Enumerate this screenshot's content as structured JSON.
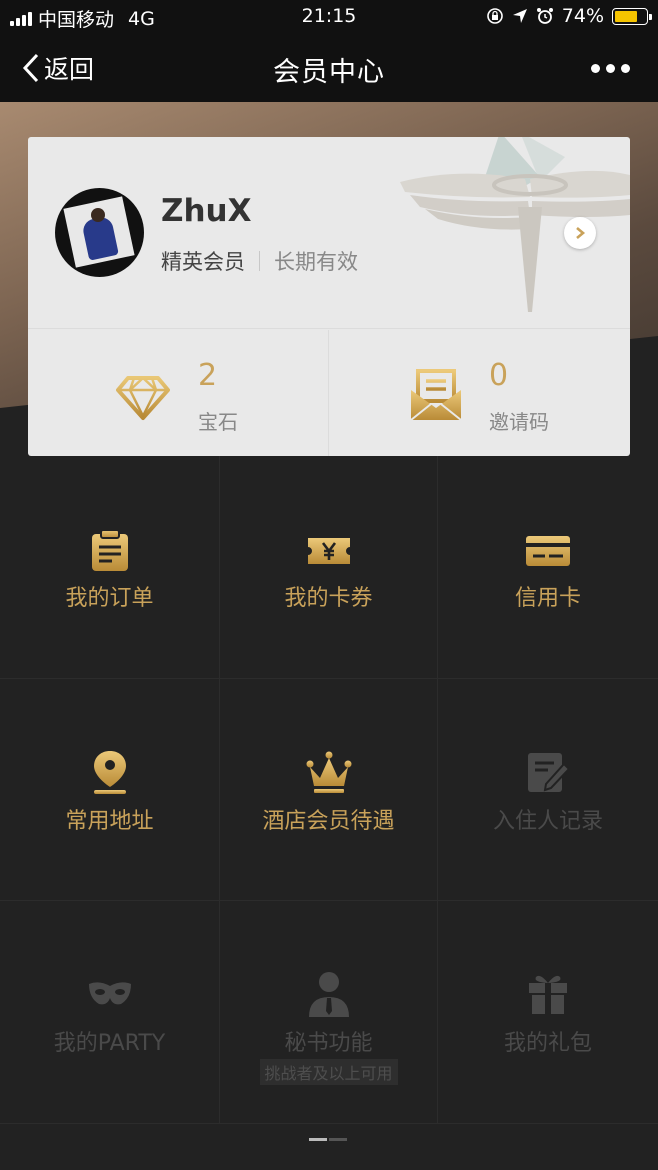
{
  "status": {
    "carrier": "中国移动",
    "network": "4G",
    "time": "21:15",
    "battery": "74%",
    "battery_level": 0.74
  },
  "nav": {
    "back_label": "返回",
    "title": "会员中心"
  },
  "card": {
    "username": "ZhuX",
    "level": "精英会员",
    "validity": "长期有效",
    "stats": [
      {
        "value": "2",
        "label": "宝石",
        "icon": "diamond-icon"
      },
      {
        "value": "0",
        "label": "邀请码",
        "icon": "envelope-icon"
      }
    ]
  },
  "grid": [
    {
      "label": "我的订单",
      "icon": "clipboard-icon",
      "enabled": true
    },
    {
      "label": "我的卡券",
      "icon": "ticket-icon",
      "enabled": true
    },
    {
      "label": "信用卡",
      "icon": "credit-card-icon",
      "enabled": true
    },
    {
      "label": "常用地址",
      "icon": "location-pin-icon",
      "enabled": true
    },
    {
      "label": "酒店会员待遇",
      "icon": "crown-icon",
      "enabled": true
    },
    {
      "label": "入住人记录",
      "icon": "edit-note-icon",
      "enabled": false
    },
    {
      "label": "我的PARTY",
      "icon": "mask-icon",
      "enabled": false
    },
    {
      "label": "秘书功能",
      "icon": "secretary-icon",
      "enabled": false,
      "note": "挑战者及以上可用"
    },
    {
      "label": "我的礼包",
      "icon": "gift-icon",
      "enabled": false
    }
  ],
  "colors": {
    "gold": "#c9a25a",
    "disabled": "#4a4a4a",
    "background": "#222222"
  }
}
